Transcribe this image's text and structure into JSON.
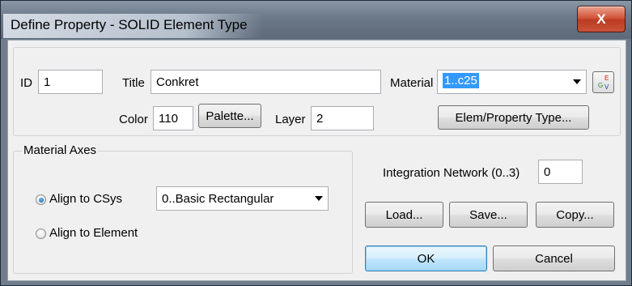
{
  "window": {
    "title": "Define Property - SOLID Element Type",
    "close_glyph": "X"
  },
  "fields": {
    "id_label": "ID",
    "id_value": "1",
    "title_label": "Title",
    "title_value": "Conkret",
    "material_label": "Material",
    "material_value": "1..c25",
    "color_label": "Color",
    "color_value": "110",
    "layer_label": "Layer",
    "layer_value": "2",
    "integration_label": "Integration Network (0..3)",
    "integration_value": "0"
  },
  "buttons": {
    "palette": "Palette...",
    "elem_property_type": "Elem/Property Type...",
    "load": "Load...",
    "save": "Save...",
    "copy": "Copy...",
    "ok": "OK",
    "cancel": "Cancel"
  },
  "material_axes": {
    "legend": "Material Axes",
    "align_csys_label": "Align to CSys",
    "align_element_label": "Align to Element",
    "selected_option": "Align to CSys",
    "csys_value": "0..Basic Rectangular"
  },
  "material_icon": {
    "name": "function-icon",
    "top": "E",
    "left": "G",
    "right": "V"
  },
  "colors": {
    "titlebar": "#6e7b8b",
    "close": "#c8533a",
    "selection": "#3399ff",
    "dialog": "#f0f0f0"
  }
}
